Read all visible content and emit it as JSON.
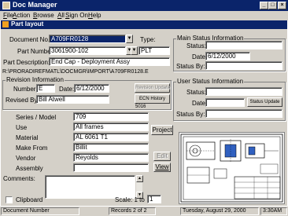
{
  "window": {
    "title": "Doc Manager",
    "minimize": "_",
    "maximize": "□",
    "close": "×"
  },
  "menu": [
    {
      "key": "F",
      "rest": "ile"
    },
    {
      "key": "A",
      "rest": "ction"
    },
    {
      "key": "B",
      "rest": "rowse"
    },
    {
      "key": "A",
      "rest": "ll"
    },
    {
      "key": "S",
      "rest": "ign On"
    },
    {
      "key": "H",
      "rest": "elp"
    }
  ],
  "subwindow": {
    "title": "Part layout"
  },
  "form": {
    "document_no_label": "Document No.:",
    "document_no": "A709FR0128",
    "type_label": "Type:",
    "type_value": "",
    "part_number_label": "Part Number:",
    "part_number": "3061900-102",
    "part_type": "PLT",
    "part_description_label": "Part Description:",
    "part_description": "End Cap - Deployment Assy",
    "path": "R:\\PRORADIREFMATL\\DOCMGR\\IMPORT\\A709FR0128.E"
  },
  "revision": {
    "group_title": "Revision Information",
    "number_label": "Number:",
    "number": "E",
    "date_label": "Date:",
    "date": "6/12/2000",
    "revision_update_btn": "Revision Update",
    "revised_by_label": "Revised By:",
    "revised_by": "Bill Atwell",
    "ecn_history_btn": "ECN History",
    "ecn_number": "5016"
  },
  "details": {
    "series_label": "Series / Model",
    "series": "709",
    "use_label": "Use",
    "use": "All frames",
    "material_label": "Material",
    "material": "AL 6061 T1",
    "make_from_label": "Make From",
    "make_from": "Billit",
    "vendor_label": "Vendor",
    "vendor": "Reyolds",
    "assembly_label": "Assembly",
    "assembly": "",
    "project_btn": "Project",
    "edit_btn": "Edit",
    "view_btn": "View"
  },
  "comments": {
    "label": "Comments:",
    "value": ""
  },
  "clipboard": {
    "label": "Clipboard",
    "checked": false
  },
  "scale": {
    "label": "Scale: 1 to",
    "value": "1"
  },
  "main_status": {
    "group_title": "Main Status Information",
    "status_label": "Status:",
    "status": "",
    "date_label": "Date:",
    "date": "6/12/2000",
    "status_by_label": "Status By:",
    "status_by": ""
  },
  "user_status": {
    "group_title": "User Status Information",
    "status_label": "Status:",
    "status": "",
    "date_label": "Date:",
    "date": "",
    "status_update_btn": "Status Update",
    "status_by_label": "Status By:",
    "status_by": ""
  },
  "statusbar": {
    "field": "Document Number",
    "records": "Records 2 of 2",
    "date": "Tuesday, August 29, 2000",
    "time": "3:30AM"
  },
  "colors": {
    "title_bar": "#0a246a",
    "face": "#d4d0c8",
    "selection": "#0a246a"
  }
}
